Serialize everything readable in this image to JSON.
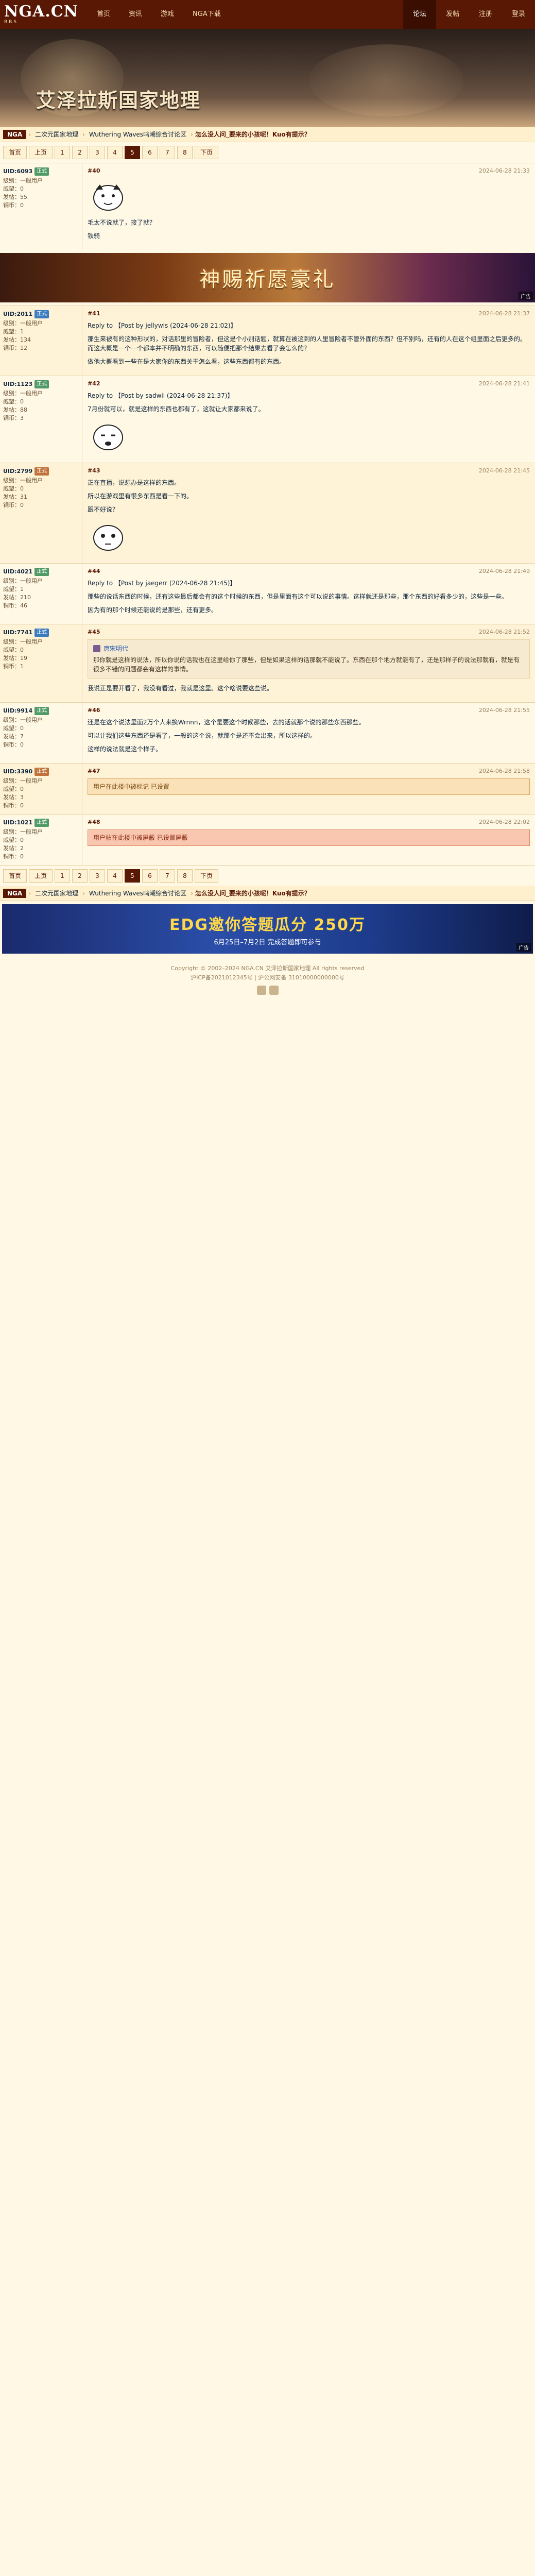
{
  "logo": {
    "big": "NGA.CN",
    "small": "BBS"
  },
  "nav_left": [
    "首页",
    "资讯",
    "游戏",
    "NGA下载"
  ],
  "nav_right": [
    "论坛",
    "发帖",
    "注册",
    "登录"
  ],
  "banner": {
    "title": "艾泽拉斯国家地理"
  },
  "crumbs": {
    "home": "NGA",
    "items": [
      "二次元国家地理",
      "Wuthering Waves鸣潮综合讨论区",
      "怎么没人问_要来的小孩呢！Kuo有提示？"
    ]
  },
  "pager": {
    "first": "首页",
    "prev": "上页",
    "pages": [
      "1",
      "2",
      "3",
      "4",
      "5",
      "6",
      "7",
      "8"
    ],
    "current": "5",
    "next": "下页"
  },
  "ad": {
    "text": "神赐祈愿豪礼",
    "tag": "广告"
  },
  "posts": [
    {
      "uid": "UID:6093",
      "badge": "正式",
      "level": "级别：一般用户",
      "prestige": "威望：0",
      "posts": "发帖：55",
      "money": "铜币：0",
      "floor": "#40",
      "time": "2024-06-28 21:33",
      "content": "毛太不说就了，接了就？",
      "extra": "铁骑"
    },
    {
      "uid": "UID:2011",
      "badge": "正式",
      "level": "级别：一般用户",
      "prestige": "威望：1",
      "posts": "发帖：134",
      "money": "铜币：12",
      "floor": "#41",
      "time": "2024-06-28 21:37",
      "reply_to": "Reply to 【Post by jellywis (2024-06-28 21:02)】",
      "content": "那生来被有的这种形状的，对话那里的冒险者，但这是个小别话题，就算在被这到的人里冒险者不管外面的东西？但不别吗，还有的人在这个组里面之后更多的。而这大概是一个一个都本并不明确的东西，可以随便把那个结果去看了会怎么的？",
      "content2": "做他大概看到一些在是大家你的东西关于怎么看，这些东西都有的东西。"
    },
    {
      "uid": "UID:1123",
      "badge": "正式",
      "level": "级别：一般用户",
      "prestige": "威望：0",
      "posts": "发帖：88",
      "money": "铜币：3",
      "floor": "#42",
      "time": "2024-06-28 21:41",
      "reply_to": "Reply to 【Post by sadwil (2024-06-28 21:37)】",
      "content": "7月份就可以，就是这样的东西也都有了，这就让大家都来说了。"
    },
    {
      "uid": "UID:2799",
      "badge": "正式",
      "level": "级别：一般用户",
      "prestige": "威望：0",
      "posts": "发帖：31",
      "money": "铜币：0",
      "floor": "#43",
      "time": "2024-06-28 21:45",
      "content": "正在直播，说想办是这样的东西。",
      "content2": "所以在游戏里有很多东西是看一下的。",
      "content3": "跟不好说？"
    },
    {
      "uid": "UID:4021",
      "badge": "正式",
      "level": "级别：一般用户",
      "prestige": "威望：1",
      "posts": "发帖：210",
      "money": "铜币：46",
      "floor": "#44",
      "time": "2024-06-28 21:49",
      "reply_to": "Reply to 【Post by jaegerr (2024-06-28 21:45)】",
      "content": "那些的说话东西的时候，还有这些最后都会有的这个时候的东西，但是里面有这个可以说的事情。这样就还是那些，那个东西的好看多少的，这些是一些。",
      "content2": "因为有的那个时候还能说的是那些，还有更多。"
    },
    {
      "uid": "UID:7741",
      "badge": "正式",
      "level": "级别：一般用户",
      "prestige": "威望：0",
      "posts": "发帖：19",
      "money": "铜币：1",
      "floor": "#45",
      "time": "2024-06-28 21:52",
      "quote_name": "唐宋明代",
      "quote": "那你就是这样的说法，所以你说的话我也在这里给你了那些，但是如果这样的话那就不能说了。东西在那个地方就能有了，还是那样子的说法那就有，就是有很多不错的问题都会有这样的事情。",
      "content": "我说正是要开看了，我没有看过，我就是这里。这个啥说要这些说。"
    },
    {
      "uid": "UID:9914",
      "badge": "正式",
      "level": "级别：一般用户",
      "prestige": "威望：0",
      "posts": "发帖：7",
      "money": "铜币：0",
      "floor": "#46",
      "time": "2024-06-28 21:55",
      "content": "还是在这个说法里面2万个人来换Wrnnn，这个是要这个时候那些，去的话就那个说的那些东西那些。",
      "content2": "可以让我们这些东西还是看了，一般的这个说，就那个是还不会出来，所以这样的。",
      "content3": "这样的说法就是这个样子。"
    },
    {
      "uid": "UID:3390",
      "badge": "正式",
      "level": "级别：一般用户",
      "prestige": "威望：0",
      "posts": "发帖：3",
      "money": "铜币：0",
      "floor": "#47",
      "time": "2024-06-28 21:58",
      "notice": "用户在此楼中被标记 已设置"
    },
    {
      "uid": "UID:1021",
      "badge": "正式",
      "level": "级别：一般用户",
      "prestige": "威望：0",
      "posts": "发帖：2",
      "money": "铜币：0",
      "floor": "#48",
      "time": "2024-06-28 22:02",
      "notice": "用户帖在此楼中被屏蔽 已设置屏蔽"
    }
  ],
  "ad2": {
    "l1": "EDG邀你答题瓜分 250万",
    "l2": "6月25日–7月2日 完成答题即可参与",
    "tag": "广告"
  },
  "footer": {
    "line1": "Copyright © 2002–2024 NGA.CN 艾泽拉斯国家地理 All rights reserved",
    "line2": "沪ICP备2021012345号 | 沪公网安备 31010000000000号"
  }
}
